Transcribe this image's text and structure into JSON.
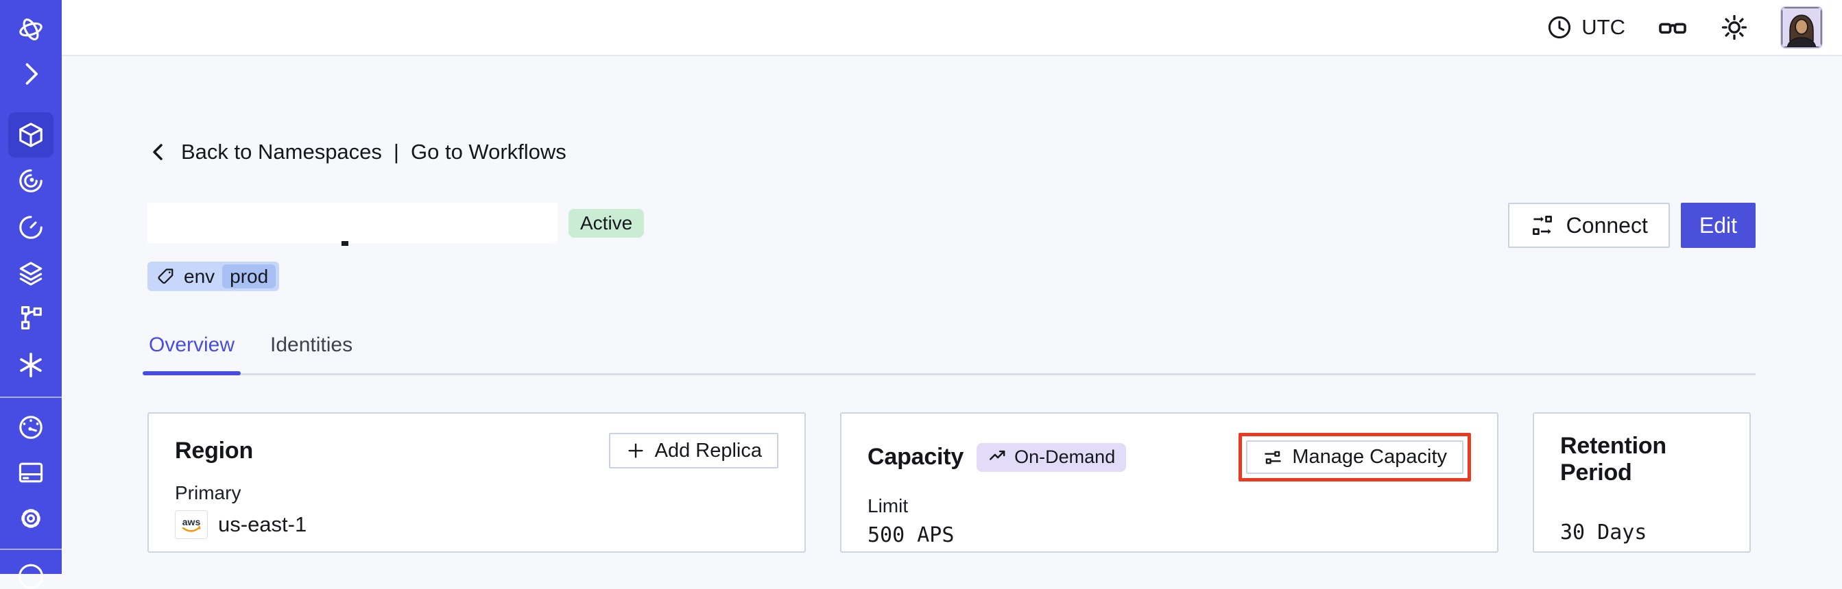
{
  "topbar": {
    "timezone": "UTC"
  },
  "breadcrumb": {
    "back": "Back to Namespaces",
    "separator": "|",
    "forward": "Go to Workflows"
  },
  "namespace": {
    "status": "Active",
    "tag_key": "env",
    "tag_value": "prod"
  },
  "actions": {
    "connect": "Connect",
    "edit": "Edit"
  },
  "tabs": [
    {
      "label": "Overview"
    },
    {
      "label": "Identities"
    }
  ],
  "cards": {
    "region": {
      "title": "Region",
      "add_replica_label": "Add Replica",
      "field_label": "Primary",
      "provider": "aws",
      "value": "us-east-1"
    },
    "capacity": {
      "title": "Capacity",
      "badge": "On-Demand",
      "manage_label": "Manage Capacity",
      "field_label": "Limit",
      "value": "500 APS"
    },
    "retention": {
      "title": "Retention Period",
      "value": "30 Days"
    }
  },
  "colors": {
    "sidebar": "#474de3",
    "accent": "#474de3",
    "edit_button": "#4b50da",
    "active_badge_bg": "#c9ecd2",
    "tag_bg": "#c7d7fb",
    "tag_chip_bg": "#a9c0f5",
    "ondemand_badge_bg": "#e2dcf9",
    "highlight_border": "#ea3b22",
    "page_bg": "#f7f8fb"
  }
}
